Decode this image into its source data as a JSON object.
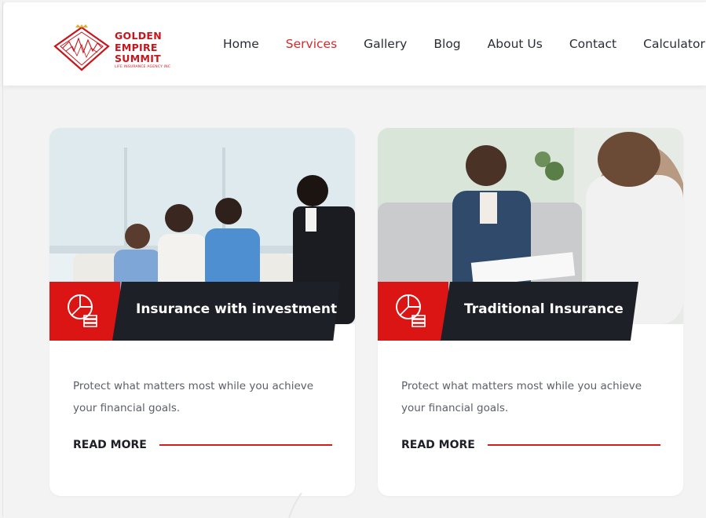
{
  "brand": {
    "name_lines": [
      "GOLDEN",
      "EMPIRE",
      "SUMMIT"
    ],
    "subtitle": "LIFE INSURANCE AGENCY INC",
    "accent": "#c8151b"
  },
  "nav": {
    "items": [
      {
        "label": "Home",
        "active": false
      },
      {
        "label": "Services",
        "active": true
      },
      {
        "label": "Gallery",
        "active": false
      },
      {
        "label": "Blog",
        "active": false
      },
      {
        "label": "About Us",
        "active": false
      },
      {
        "label": "Contact",
        "active": false
      },
      {
        "label": "Calculator",
        "active": false
      }
    ],
    "active_color": "#d22c2c"
  },
  "cards": [
    {
      "title": "Insurance with investment",
      "description": "Protect what matters most while you achieve your financial goals.",
      "cta": "READ MORE",
      "icon": "chart-coins-icon"
    },
    {
      "title": "Traditional Insurance",
      "description": "Protect what matters most while you achieve your financial goals.",
      "cta": "READ MORE",
      "icon": "chart-coins-icon"
    }
  ],
  "colors": {
    "badge_red": "#db1414",
    "badge_dark": "#1d2027",
    "page_bg": "#f3f3f4"
  }
}
